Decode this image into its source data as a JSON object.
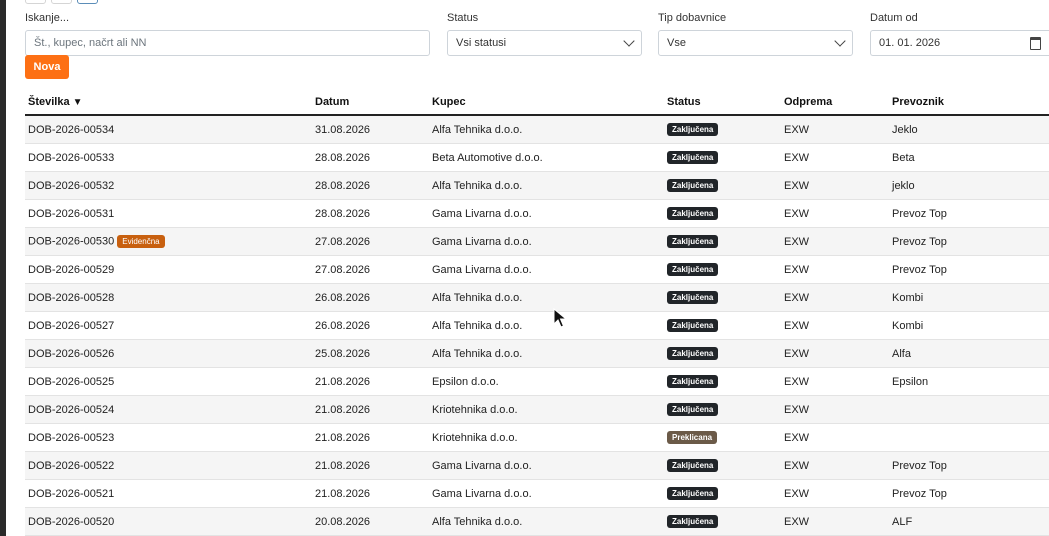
{
  "filters": {
    "search": {
      "label": "Iskanje...",
      "placeholder": "Št., kupec, načrt ali NN"
    },
    "status": {
      "label": "Status",
      "value": "Vsi statusi"
    },
    "type": {
      "label": "Tip dobavnice",
      "value": "Vse"
    },
    "date_from": {
      "label": "Datum od",
      "value": "01. 01. 2026"
    }
  },
  "toolbar": {
    "new_label": "Nova"
  },
  "table": {
    "columns": {
      "number": "Številka",
      "sort_indicator": "▼",
      "date": "Datum",
      "customer": "Kupec",
      "status": "Status",
      "shipping": "Odprema",
      "carrier": "Prevoznik"
    },
    "rows": [
      {
        "number": "DOB-2026-00534",
        "date": "31.08.2026",
        "customer": "Alfa Tehnika d.o.o.",
        "status": "Zaključena",
        "shipping": "EXW",
        "carrier": "Jeklo"
      },
      {
        "number": "DOB-2026-00533",
        "date": "28.08.2026",
        "customer": "Beta Automotive d.o.o.",
        "status": "Zaključena",
        "shipping": "EXW",
        "carrier": "Beta"
      },
      {
        "number": "DOB-2026-00532",
        "date": "28.08.2026",
        "customer": "Alfa Tehnika d.o.o.",
        "status": "Zaključena",
        "shipping": "EXW",
        "carrier": "jeklo"
      },
      {
        "number": "DOB-2026-00531",
        "date": "28.08.2026",
        "customer": "Gama Livarna d.o.o.",
        "status": "Zaključena",
        "shipping": "EXW",
        "carrier": "Prevoz Top"
      },
      {
        "number": "DOB-2026-00530",
        "tag": "Evidenčna",
        "date": "27.08.2026",
        "customer": "Gama Livarna d.o.o.",
        "status": "Zaključena",
        "shipping": "EXW",
        "carrier": "Prevoz Top"
      },
      {
        "number": "DOB-2026-00529",
        "date": "27.08.2026",
        "customer": "Gama Livarna d.o.o.",
        "status": "Zaključena",
        "shipping": "EXW",
        "carrier": "Prevoz Top"
      },
      {
        "number": "DOB-2026-00528",
        "date": "26.08.2026",
        "customer": "Alfa Tehnika d.o.o.",
        "status": "Zaključena",
        "shipping": "EXW",
        "carrier": "Kombi"
      },
      {
        "number": "DOB-2026-00527",
        "date": "26.08.2026",
        "customer": "Alfa Tehnika d.o.o.",
        "status": "Zaključena",
        "shipping": "EXW",
        "carrier": "Kombi"
      },
      {
        "number": "DOB-2026-00526",
        "date": "25.08.2026",
        "customer": "Alfa Tehnika d.o.o.",
        "status": "Zaključena",
        "shipping": "EXW",
        "carrier": "Alfa"
      },
      {
        "number": "DOB-2026-00525",
        "date": "21.08.2026",
        "customer": "Epsilon d.o.o.",
        "status": "Zaključena",
        "shipping": "EXW",
        "carrier": "Epsilon"
      },
      {
        "number": "DOB-2026-00524",
        "date": "21.08.2026",
        "customer": "Kriotehnika d.o.o.",
        "status": "Zaključena",
        "shipping": "EXW",
        "carrier": ""
      },
      {
        "number": "DOB-2026-00523",
        "date": "21.08.2026",
        "customer": "Kriotehnika d.o.o.",
        "status": "Preklicana",
        "shipping": "EXW",
        "carrier": ""
      },
      {
        "number": "DOB-2026-00522",
        "date": "21.08.2026",
        "customer": "Gama Livarna d.o.o.",
        "status": "Zaključena",
        "shipping": "EXW",
        "carrier": "Prevoz Top"
      },
      {
        "number": "DOB-2026-00521",
        "date": "21.08.2026",
        "customer": "Gama Livarna d.o.o.",
        "status": "Zaključena",
        "shipping": "EXW",
        "carrier": "Prevoz Top"
      },
      {
        "number": "DOB-2026-00520",
        "date": "20.08.2026",
        "customer": "Alfa Tehnika d.o.o.",
        "status": "Zaključena",
        "shipping": "EXW",
        "carrier": "ALF"
      }
    ]
  },
  "colors": {
    "accent": "#fd7014",
    "closed_badge": "#212529",
    "cancelled_badge": "#6b5a48",
    "evidence_badge": "#c8600f"
  },
  "icons": {
    "select": "chevron-down-icon",
    "date": "calendar-icon",
    "pointer": "mouse-cursor-icon"
  }
}
